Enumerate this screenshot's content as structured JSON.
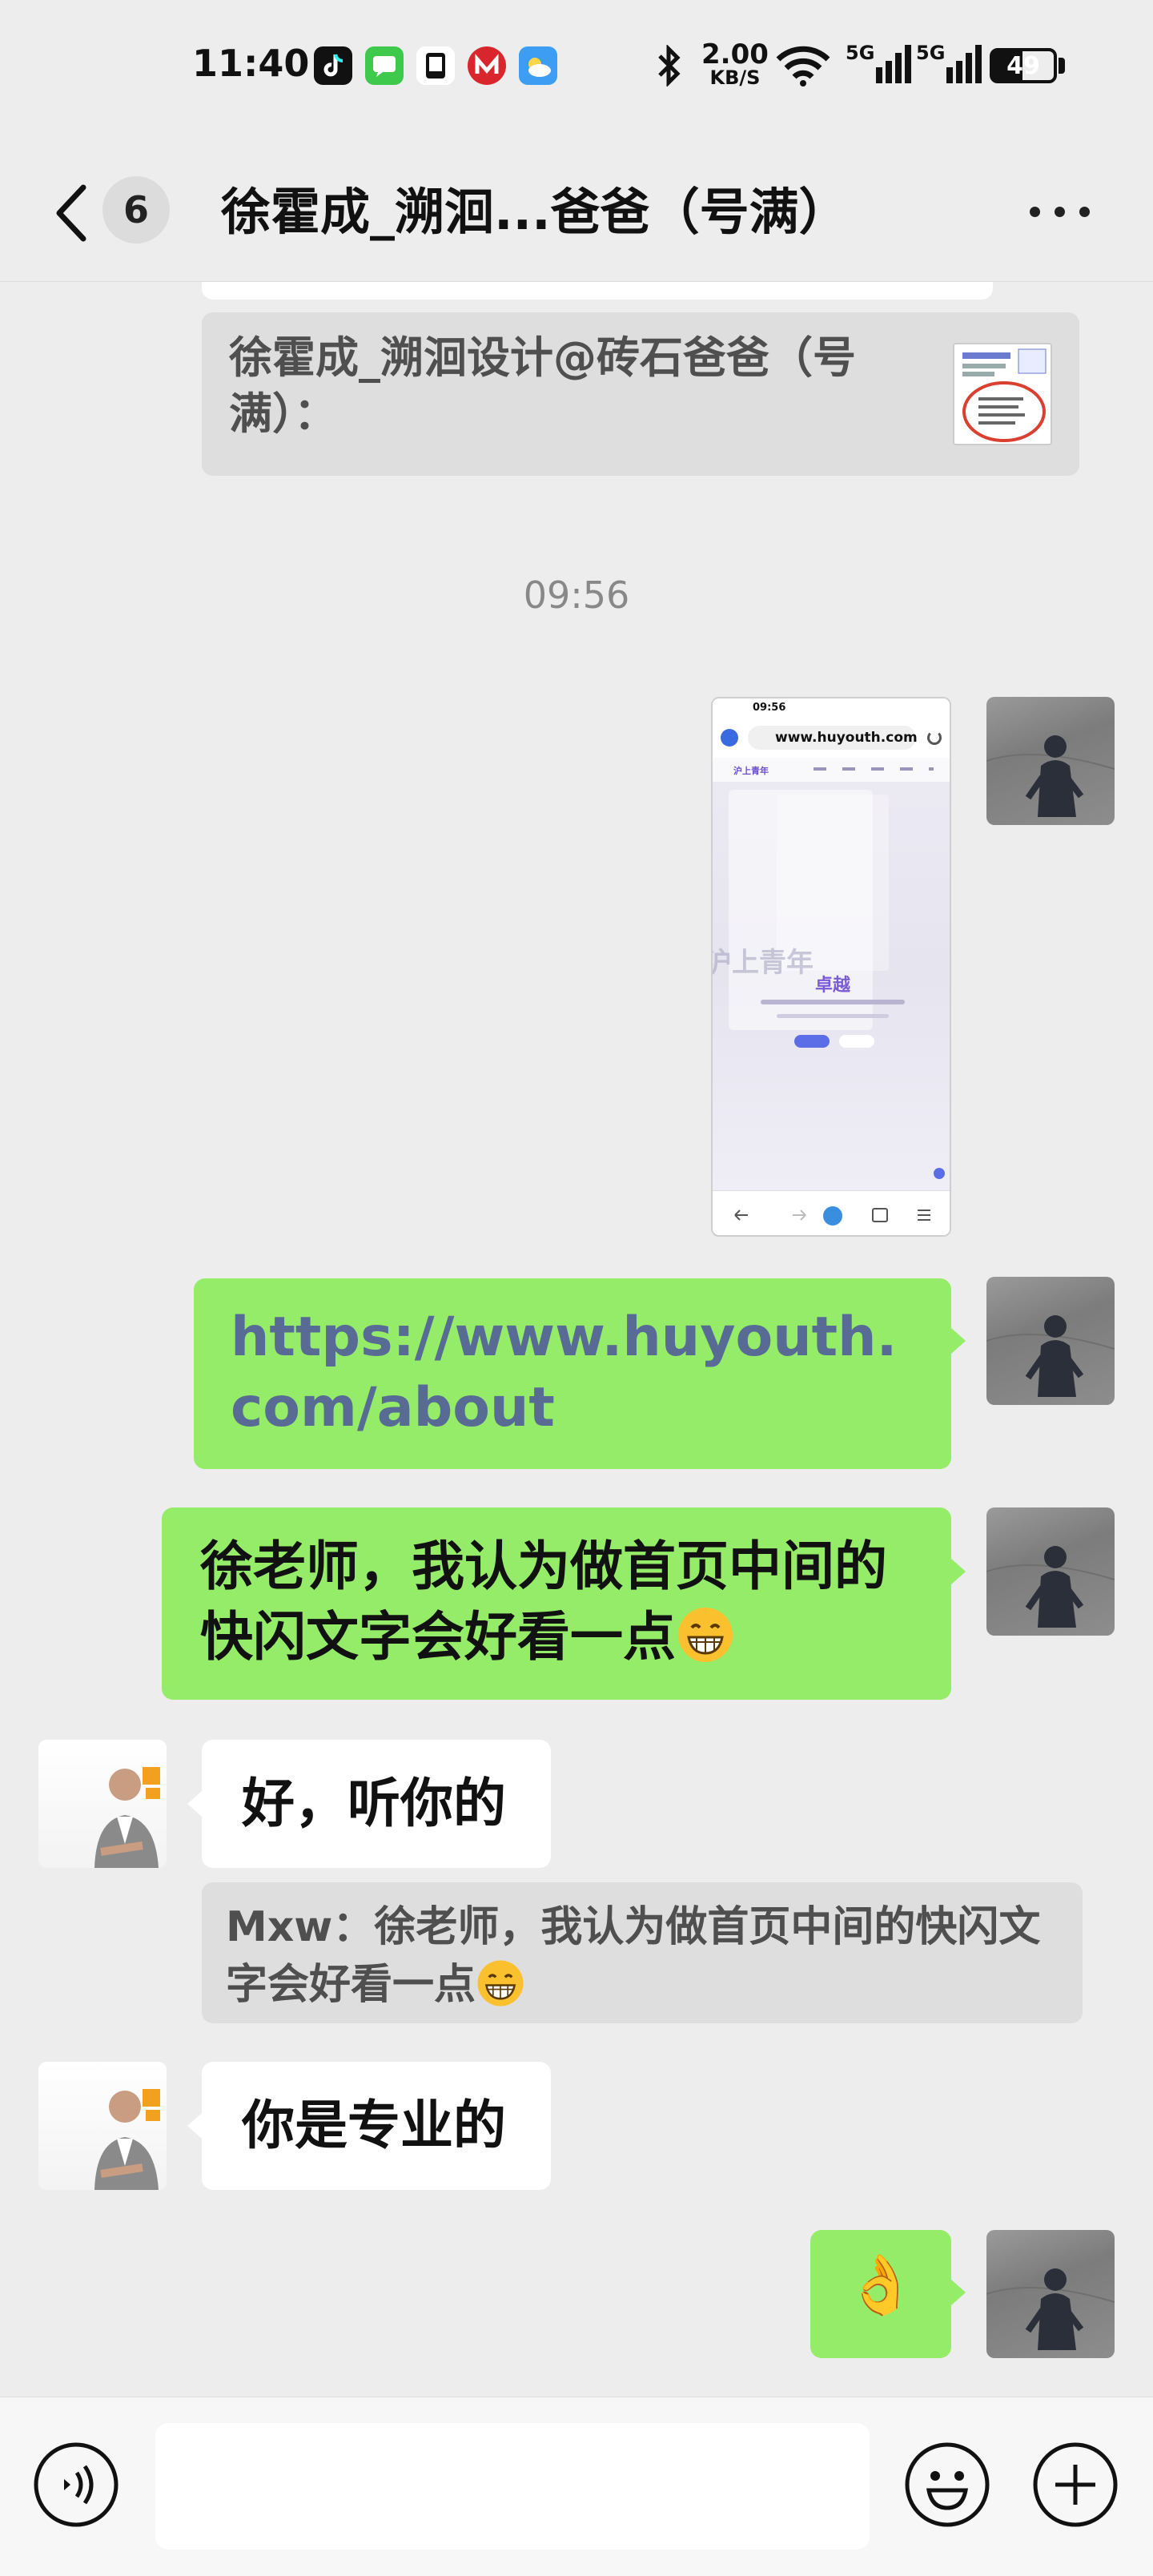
{
  "status_bar": {
    "time": "11:40",
    "net_speed_value": "2.00",
    "net_speed_unit": "KB/S",
    "signal_1": "5G",
    "signal_2": "5G",
    "battery": "49",
    "battery_level": 0.49
  },
  "header": {
    "unread_count": "6",
    "title": "徐霍成_溯洄...爸爸（号满）"
  },
  "messages": {
    "quote_top": "徐霍成_溯洄设计@砖石爸爸（号满）：",
    "timestamp": "09:56",
    "screenshot": {
      "time": "09:56",
      "url": "www.huyouth.com",
      "brand": "沪上青年",
      "headline": "卓越",
      "watermark": "沪上青年"
    },
    "link": "https://www.huyouth.com/about",
    "self_text": "徐老师，我认为做首页中间的快闪文字会好看一点",
    "reply_1": "好，听你的",
    "quote_reply": "Mxw：徐老师，我认为做首页中间的快闪文字会好看一点",
    "reply_2": "你是专业的",
    "last_emoji": "👌"
  },
  "colors": {
    "background": "#ededed",
    "bubble_self": "#95ec69",
    "bubble_other": "#ffffff",
    "link": "#576b95"
  },
  "icons": [
    "back-icon",
    "more-icon",
    "voice-icon",
    "emoji-icon",
    "plus-icon"
  ]
}
